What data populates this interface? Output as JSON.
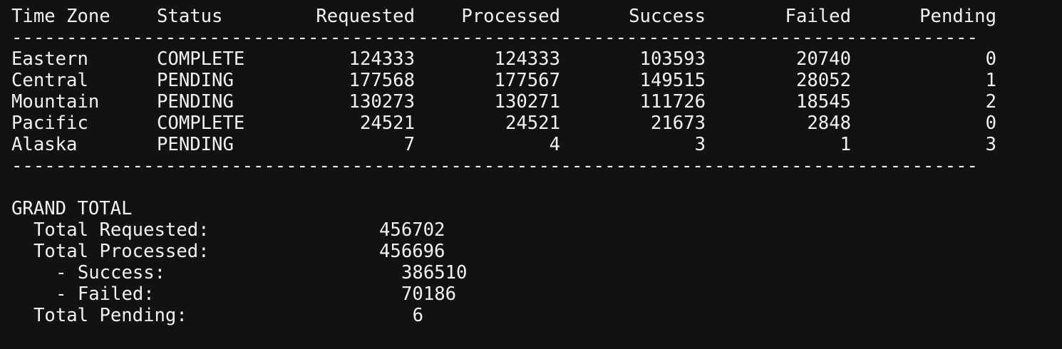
{
  "table": {
    "headers": [
      "Time Zone",
      "Status",
      "Requested",
      "Processed",
      "Success",
      "Failed",
      "Pending"
    ],
    "separator": "----------------------------------------------------------------------------------------",
    "rows": [
      {
        "zone": "Eastern",
        "status": "COMPLETE",
        "requested": "124333",
        "processed": "124333",
        "success": "103593",
        "failed": "20740",
        "pending": "0"
      },
      {
        "zone": "Central",
        "status": "PENDING",
        "requested": "177568",
        "processed": "177567",
        "success": "149515",
        "failed": "28052",
        "pending": "1"
      },
      {
        "zone": "Mountain",
        "status": "PENDING",
        "requested": "130273",
        "processed": "130271",
        "success": "111726",
        "failed": "18545",
        "pending": "2"
      },
      {
        "zone": "Pacific",
        "status": "COMPLETE",
        "requested": "24521",
        "processed": "24521",
        "success": "21673",
        "failed": "2848",
        "pending": "0"
      },
      {
        "zone": "Alaska",
        "status": "PENDING",
        "requested": "7",
        "processed": "4",
        "success": "3",
        "failed": "1",
        "pending": "3"
      }
    ]
  },
  "summary": {
    "title": "GRAND TOTAL",
    "total_requested_label": "Total Requested:",
    "total_requested_value": "456702",
    "total_processed_label": "Total Processed:",
    "total_processed_value": "456696",
    "success_label": "- Success:",
    "success_value": "386510",
    "failed_label": "- Failed:",
    "failed_value": "70186",
    "total_pending_label": "Total Pending:",
    "total_pending_value": "6"
  }
}
